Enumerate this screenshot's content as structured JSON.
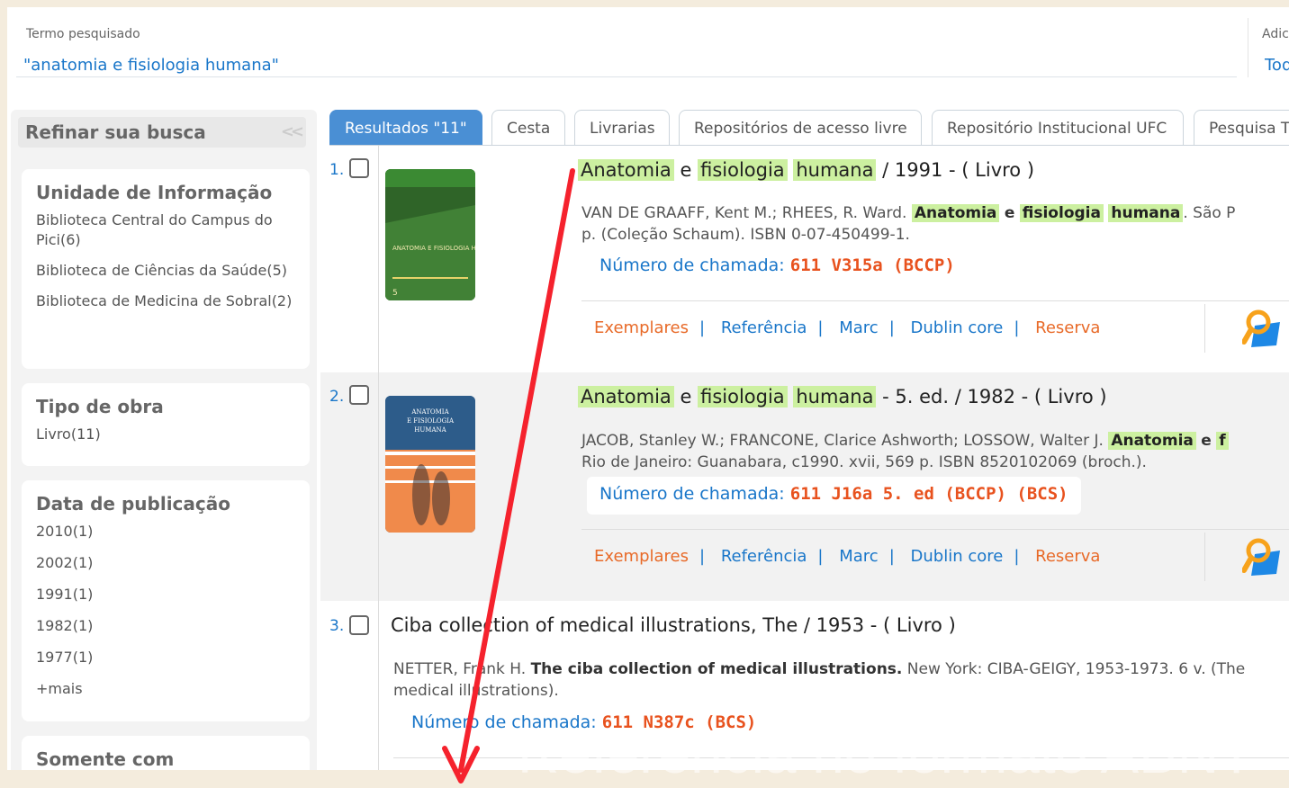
{
  "search": {
    "term_label": "Termo pesquisado",
    "term_value": "\"anatomia e fisiologia humana\"",
    "add_label": "Adic",
    "add_value": "Tod"
  },
  "sidebar": {
    "title": "Refinar sua busca",
    "collapse_icon": "double-chevron-left",
    "facets": [
      {
        "title": "Unidade de Informação",
        "items": [
          "Biblioteca Central do Campus do Pici(6)",
          "Biblioteca de Ciências da Saúde(5)",
          "Biblioteca de Medicina de Sobral(2)"
        ]
      },
      {
        "title": "Tipo de obra",
        "items": [
          "Livro(11)"
        ]
      },
      {
        "title": "Data de publicação",
        "items": [
          "2010(1)",
          "2002(1)",
          "1991(1)",
          "1982(1)",
          "1977(1)",
          "+mais"
        ]
      },
      {
        "title": "Somente com",
        "items": []
      }
    ]
  },
  "tabs": [
    "Resultados \"11\"",
    "Cesta",
    "Livrarias",
    "Repositórios de acesso livre",
    "Repositório Institucional UFC",
    "Pesquisa T"
  ],
  "results": [
    {
      "num": "1.",
      "title_words": [
        "Anatomia",
        "e",
        "fisiologia",
        "humana"
      ],
      "title_rest": "/ 1991 -  ( Livro )",
      "desc_line1_pre": "VAN DE GRAAFF, Kent M.; RHEES, R. Ward.",
      "desc_line1_words": [
        "Anatomia",
        "e",
        "fisiologia",
        "humana"
      ],
      "desc_line1_post": ". São P",
      "desc_line2": "p. (Coleção Schaum). ISBN 0-07-450499-1.",
      "call_label": "Número de chamada:",
      "call_value": "611 V315a (BCCP)",
      "cover_text": "ANATOMIA E FISIOLOGIA HUMANA",
      "cover_color": "#3f7a36"
    },
    {
      "num": "2.",
      "title_words": [
        "Anatomia",
        "e",
        "fisiologia",
        "humana"
      ],
      "title_rest": "- 5. ed. / 1982 -  ( Livro )",
      "desc_line1_pre": "JACOB, Stanley W.; FRANCONE, Clarice Ashworth; LOSSOW, Walter J.",
      "desc_line1_words": [
        "Anatomia",
        "e",
        "f"
      ],
      "desc_line1_post": "",
      "desc_line2": "Rio de Janeiro: Guanabara, c1990. xvii, 569 p. ISBN 8520102069 (broch.).",
      "call_label": "Número de chamada:",
      "call_value": "611 J16a 5. ed (BCCP) (BCS)",
      "cover_text": "ANATOMIA E FISIOLOGIA HUMANA",
      "cover_color": "#2d5c8a"
    },
    {
      "num": "3.",
      "title": "Ciba collection of medical illustrations, The / 1953 -  ( Livro )",
      "desc_line1_pre": "NETTER, Frank H.",
      "desc_line1_bold": "The ciba collection of medical illustrations.",
      "desc_line1_post": "New York: CIBA-GEIGY, 1953-1973. 6 v. (The",
      "desc_line2": "medical illustrations).",
      "call_label": "Número de chamada:",
      "call_value": "611 N387c (BCS)"
    }
  ],
  "actions": [
    "Exemplares",
    "Referência",
    "Marc",
    "Dublin core",
    "Reserva"
  ],
  "action_icon": "search-document-icon",
  "overlay_caption": "Referência no formato ABNT",
  "colors": {
    "accent_blue": "#1976c9",
    "orange": "#e86a28",
    "highlight": "#ccf0a0",
    "arrow": "#f5222d"
  }
}
